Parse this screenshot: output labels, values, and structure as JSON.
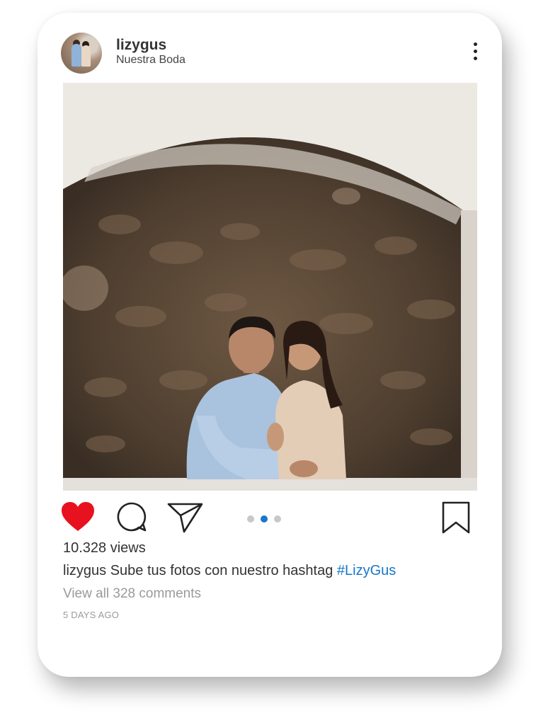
{
  "post": {
    "username": "lizygus",
    "location": "Nuestra Boda",
    "views": "10.328 views",
    "caption_user": "lizygus",
    "caption_text": " Sube tus fotos con nuestro hashtag ",
    "caption_hashtag": "#LizyGus",
    "comments_link": "View all 328 comments",
    "timestamp": "5 DAYS AGO"
  },
  "icons": {
    "like": "heart-icon",
    "comment": "comment-bubble-icon",
    "share": "paper-plane-icon",
    "save": "bookmark-icon",
    "menu": "more-vertical-icon"
  },
  "carousel": {
    "total": 3,
    "active_index": 1
  },
  "colors": {
    "like": "#e8111f",
    "accent": "#1777c8",
    "muted": "#9a9a9a"
  }
}
